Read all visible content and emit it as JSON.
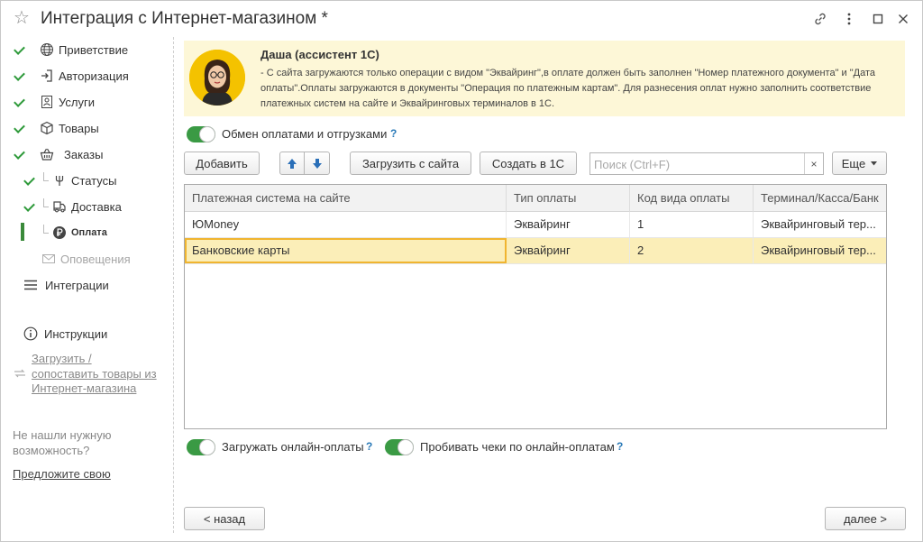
{
  "window": {
    "title": "Интеграция с Интернет-магазином *"
  },
  "sidebar": {
    "items": [
      {
        "label": "Приветствие"
      },
      {
        "label": "Авторизация"
      },
      {
        "label": "Услуги"
      },
      {
        "label": "Товары"
      },
      {
        "label": "Заказы"
      },
      {
        "label": "Статусы"
      },
      {
        "label": "Доставка"
      },
      {
        "label": "Оплата"
      },
      {
        "label": "Оповещения"
      },
      {
        "label": "Интеграции"
      }
    ],
    "instructions_label": "Инструкции",
    "load_link_line1": "Загрузить /",
    "load_link_line2": "сопоставить товары из",
    "load_link_line3": "Интернет-магазина",
    "not_found_line1": "Не нашли нужную",
    "not_found_line2": "возможность?",
    "suggest_link": "Предложите свою"
  },
  "assistant": {
    "name": "Даша (ассистент 1С)",
    "text": "- С сайта загружаются только операции с видом \"Эквайринг\",в оплате должен быть заполнен \"Номер платежного документа\" и \"Дата оплаты\".Оплаты загружаются в документы \"Операция по платежным картам\". Для разнесения оплат нужно заполнить соответствие платежных систем на сайте и Эквайринговых терминалов в 1С."
  },
  "exchange_toggle": {
    "label": "Обмен оплатами и отгрузками",
    "on": true,
    "help": "?"
  },
  "toolbar": {
    "add_label": "Добавить",
    "load_from_site_label": "Загрузить с сайта",
    "create_in_1c_label": "Создать в 1С",
    "search_placeholder": "Поиск (Ctrl+F)",
    "clear_label": "×",
    "more_label": "Еще"
  },
  "table": {
    "columns": [
      "Платежная система на сайте",
      "Тип оплаты",
      "Код вида оплаты",
      "Терминал/Касса/Банк"
    ],
    "rows": [
      {
        "system": "ЮMoney",
        "type": "Эквайринг",
        "code": "1",
        "terminal": "Эквайринговый тер..."
      },
      {
        "system": "Банковские карты",
        "type": "Эквайринг",
        "code": "2",
        "terminal": "Эквайринговый тер..."
      }
    ]
  },
  "bottom_toggles": {
    "load_online_label": "Загружать онлайн-оплаты",
    "load_online_on": true,
    "print_receipts_label": "Пробивать чеки по онлайн-оплатам",
    "print_receipts_on": true,
    "help": "?"
  },
  "nav": {
    "back_label": "< назад",
    "next_label": "далее >"
  },
  "colors": {
    "accent_green": "#3a9a44",
    "assistant_bg": "#fdf7d7",
    "selected_row": "#fbeeb8",
    "help_blue": "#2a7ab8"
  }
}
